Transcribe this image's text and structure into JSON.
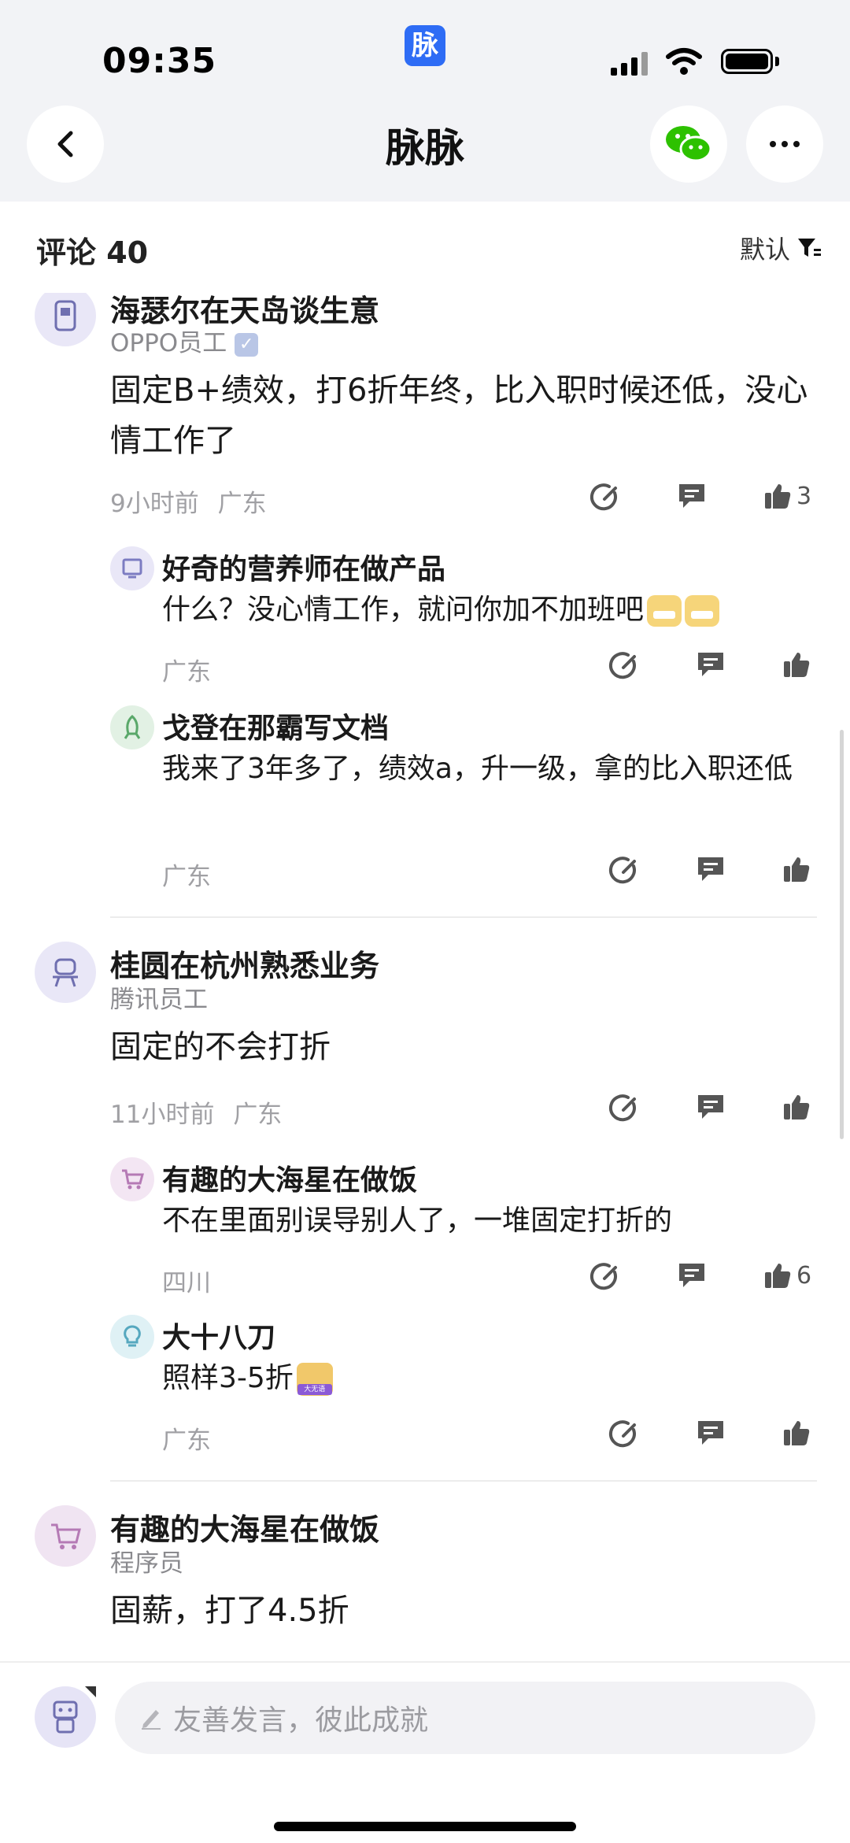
{
  "status_bar": {
    "time": "09:35",
    "app_badge": "脉"
  },
  "nav": {
    "title": "脉脉"
  },
  "comments_header": {
    "count_label": "评论 40",
    "sort_label": "默认"
  },
  "comments": [
    {
      "author": "海瑟尔在天岛谈生意",
      "subtitle": "OPPO员工",
      "verified": true,
      "text": "固定B+绩效，打6折年终，比入职时候还低，没心情工作了",
      "time": "9小时前",
      "location": "广东",
      "likes": "3",
      "replies": [
        {
          "author": "好奇的营养师在做产品",
          "text": "什么？没心情工作，就问你加不加班吧",
          "emoji_count": 2,
          "location": "广东"
        },
        {
          "author": "戈登在那霸写文档",
          "text": "我来了3年多了，绩效a，升一级，拿的比入职还低",
          "location": "广东"
        }
      ]
    },
    {
      "author": "桂圆在杭州熟悉业务",
      "subtitle": "腾讯员工",
      "text": "固定的不会打折",
      "time": "11小时前",
      "location": "广东",
      "likes": "",
      "replies": [
        {
          "author": "有趣的大海星在做饭",
          "text": "不在里面别误导别人了，一堆固定打折的",
          "location": "四川",
          "likes": "6"
        },
        {
          "author": "大十八刀",
          "text": "照样3-5折",
          "sticker": "大无语",
          "location": "广东"
        }
      ]
    },
    {
      "author": "有趣的大海星在做饭",
      "subtitle": "程序员",
      "text": "固薪，打了4.5折"
    }
  ],
  "composer": {
    "placeholder": "友善发言，彼此成就"
  },
  "colors": {
    "accent": "#2e6cf5",
    "wechat_green": "#2dc100",
    "background_top": "#f2f3f6"
  }
}
